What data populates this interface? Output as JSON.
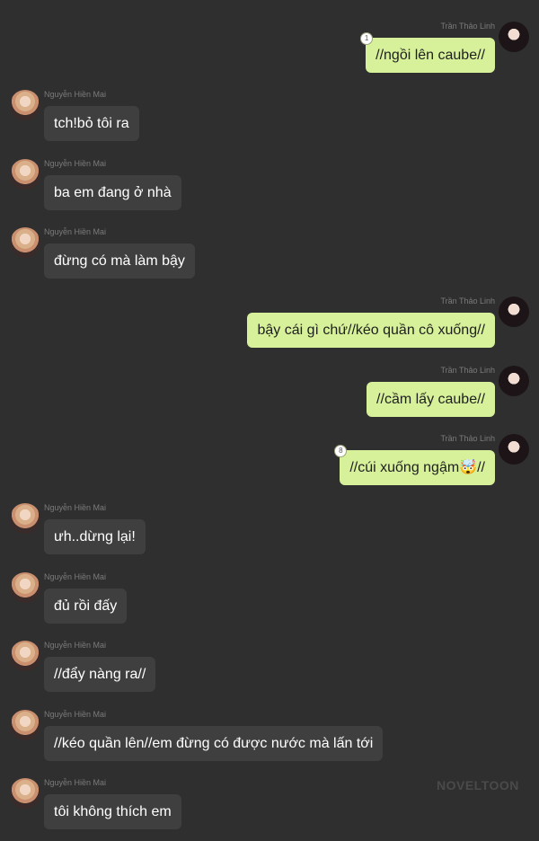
{
  "contacts": {
    "left_name": "Nguyễn Hiền Mai",
    "right_name": "Trần Thảo Linh"
  },
  "messages": [
    {
      "side": "right",
      "text": "//ngồi lên caube//",
      "badge": "1"
    },
    {
      "side": "left",
      "text": "tch!bỏ tôi ra"
    },
    {
      "side": "left",
      "text": "ba em đang ở nhà"
    },
    {
      "side": "left",
      "text": "đừng có mà làm bậy"
    },
    {
      "side": "right",
      "text": "bậy cái gì chứ//kéo quần cô xuống//"
    },
    {
      "side": "right",
      "text": "//cầm lấy caube//"
    },
    {
      "side": "right",
      "text": "//cúi xuống ngậm🤯//",
      "badge": "8"
    },
    {
      "side": "left",
      "text": "ưh..dừng lại!"
    },
    {
      "side": "left",
      "text": "đủ rồi đấy"
    },
    {
      "side": "left",
      "text": "//đẩy nàng ra//"
    },
    {
      "side": "left",
      "text": "//kéo quần lên//em đừng có được nước mà lấn tới"
    },
    {
      "side": "left",
      "text": "tôi không thích em"
    }
  ],
  "watermark": "NOVELTOON",
  "colors": {
    "background": "#2f2f2f",
    "left_bubble": "#3f3f3f",
    "right_bubble": "#d7f19a"
  }
}
